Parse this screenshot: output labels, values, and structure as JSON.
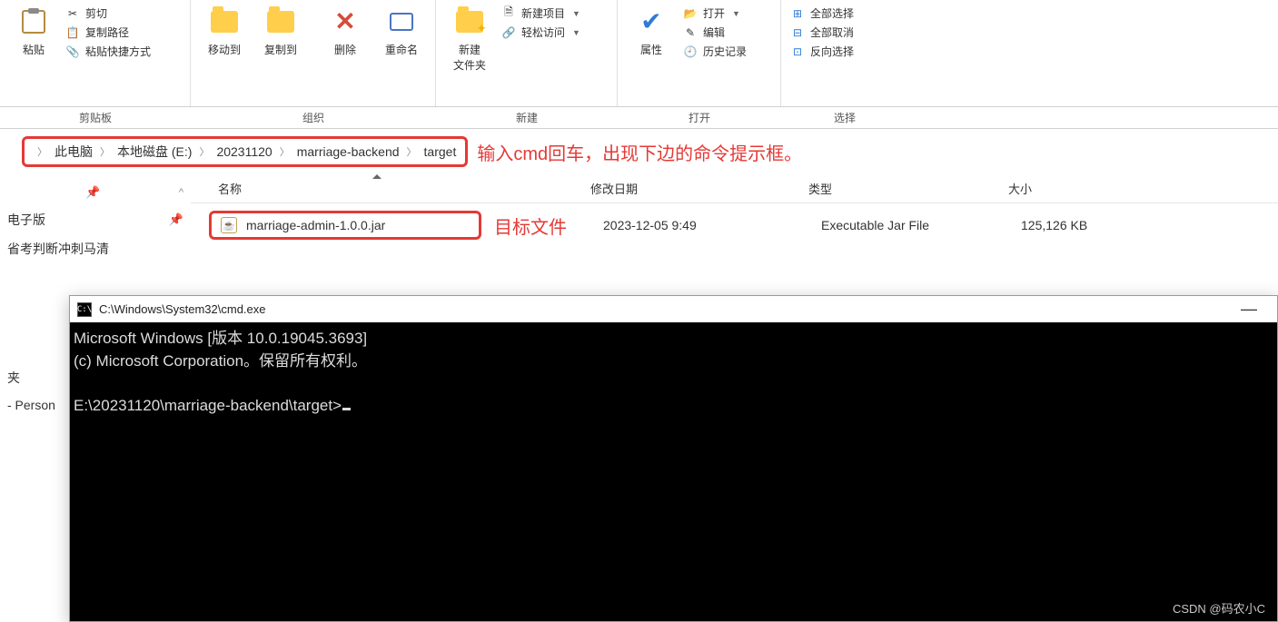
{
  "ribbon": {
    "paste": "粘贴",
    "cut": "剪切",
    "copy_path": "复制路径",
    "paste_shortcut": "粘贴快捷方式",
    "move_to": "移动到",
    "copy_to": "复制到",
    "delete": "删除",
    "rename": "重命名",
    "new_folder": "新建\n文件夹",
    "new_item": "新建项目",
    "easy_access": "轻松访问",
    "properties": "属性",
    "open": "打开",
    "edit": "编辑",
    "history": "历史记录",
    "select_all": "全部选择",
    "select_none": "全部取消",
    "invert": "反向选择",
    "groups": {
      "clipboard": "剪贴板",
      "organize": "组织",
      "new": "新建",
      "open": "打开",
      "select": "选择"
    }
  },
  "breadcrumb": {
    "items": [
      "此电脑",
      "本地磁盘 (E:)",
      "20231120",
      "marriage-backend",
      "target"
    ]
  },
  "annotations": {
    "cmd_hint": "输入cmd回车，出现下边的命令提示框。",
    "target_file": "目标文件"
  },
  "nav": {
    "item1": "电子版",
    "item2": "省考判断冲刺马清",
    "item3": "夹",
    "item4": " - Person"
  },
  "columns": {
    "name": "名称",
    "date": "修改日期",
    "type": "类型",
    "size": "大小"
  },
  "file": {
    "name": "marriage-admin-1.0.0.jar",
    "date": "2023-12-05 9:49",
    "type": "Executable Jar File",
    "size": "125,126 KB"
  },
  "cmd": {
    "title": "C:\\Windows\\System32\\cmd.exe",
    "line1": "Microsoft Windows [版本 10.0.19045.3693]",
    "line2": "(c) Microsoft Corporation。保留所有权利。",
    "prompt": "E:\\20231120\\marriage-backend\\target>"
  },
  "watermark": "CSDN @码农小C"
}
